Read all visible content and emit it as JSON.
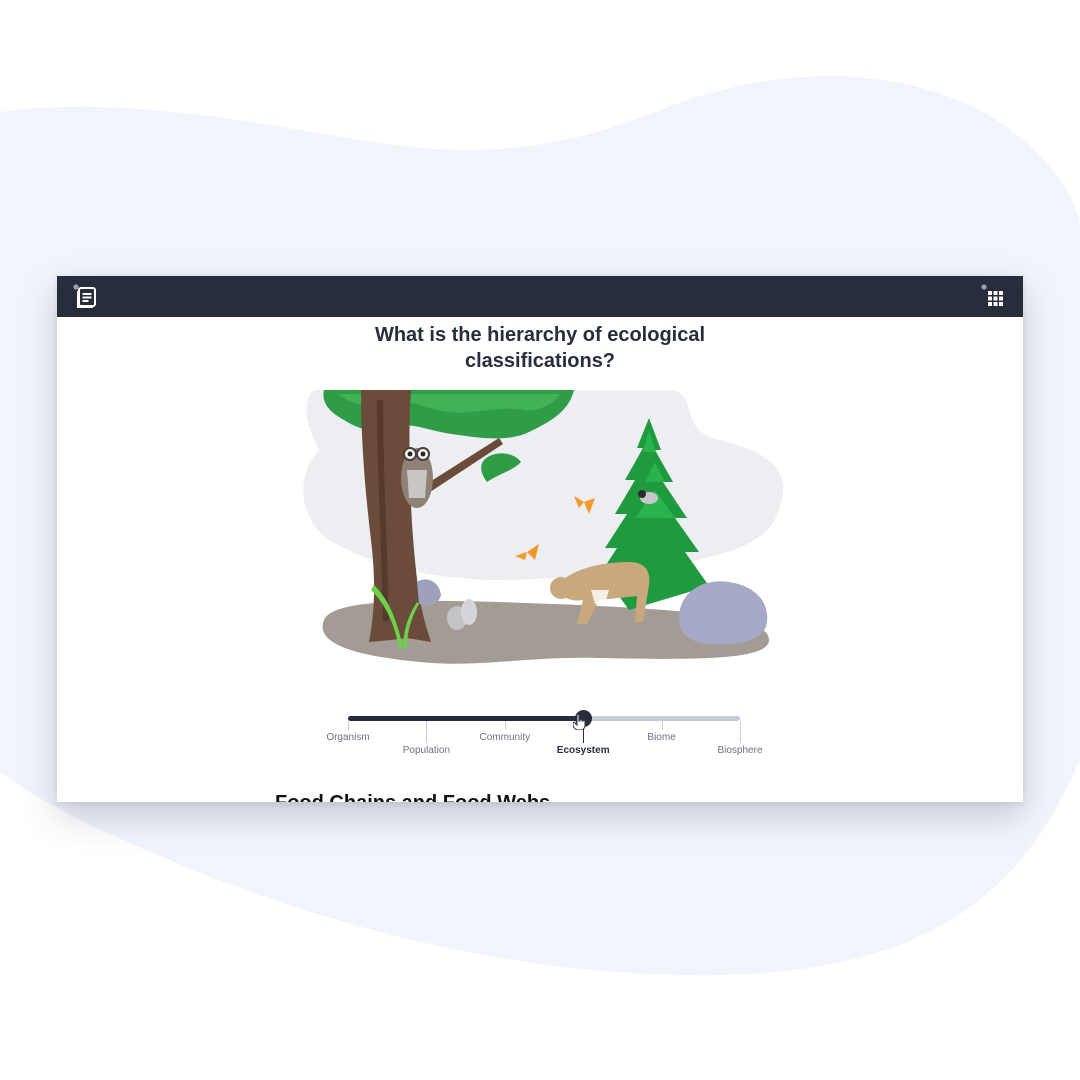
{
  "page": {
    "title": "What is the hierarchy of ecological classifications?"
  },
  "toolbar": {
    "left_icon": "notes-icon",
    "right_icon": "grid-menu-icon"
  },
  "slider": {
    "levels": [
      "Organism",
      "Population",
      "Community",
      "Ecosystem",
      "Biome",
      "Biosphere"
    ],
    "selected_index": 3,
    "selected_label": "Ecosystem"
  },
  "next_section": {
    "heading": "Food Chains and Food Webs"
  },
  "colors": {
    "topbar": "#272d3b",
    "background_blob": "#f1f5fb",
    "slider_active": "#272d3b",
    "slider_inactive": "#c6ccd7"
  }
}
